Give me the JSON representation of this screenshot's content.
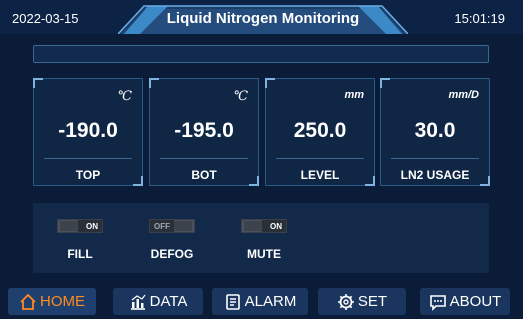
{
  "header": {
    "date": "2022-03-15",
    "title": "Liquid Nitrogen Monitoring",
    "time": "15:01:19"
  },
  "status_bar": {
    "text": ""
  },
  "readouts": [
    {
      "unit": "℃",
      "value": "-190.0",
      "label": "TOP"
    },
    {
      "unit": "℃",
      "value": "-195.0",
      "label": "BOT"
    },
    {
      "unit": "mm",
      "value": "250.0",
      "label": "LEVEL"
    },
    {
      "unit": "mm/D",
      "value": "30.0",
      "label": "LN2 USAGE"
    }
  ],
  "controls": [
    {
      "label": "FILL",
      "state": "ON"
    },
    {
      "label": "DEFOG",
      "state": "OFF"
    },
    {
      "label": "MUTE",
      "state": "ON"
    }
  ],
  "nav": {
    "items": [
      {
        "label": "HOME",
        "icon": "home-icon",
        "active": true
      },
      {
        "label": "DATA",
        "icon": "chart-icon",
        "active": false
      },
      {
        "label": "ALARM",
        "icon": "clipboard-icon",
        "active": false
      },
      {
        "label": "SET",
        "icon": "gear-icon",
        "active": false
      },
      {
        "label": "ABOUT",
        "icon": "message-icon",
        "active": false
      }
    ]
  },
  "colors": {
    "background": "#0b1c38",
    "accent_active": "#ff8a1e",
    "header_tab": "#2f6fa8"
  }
}
